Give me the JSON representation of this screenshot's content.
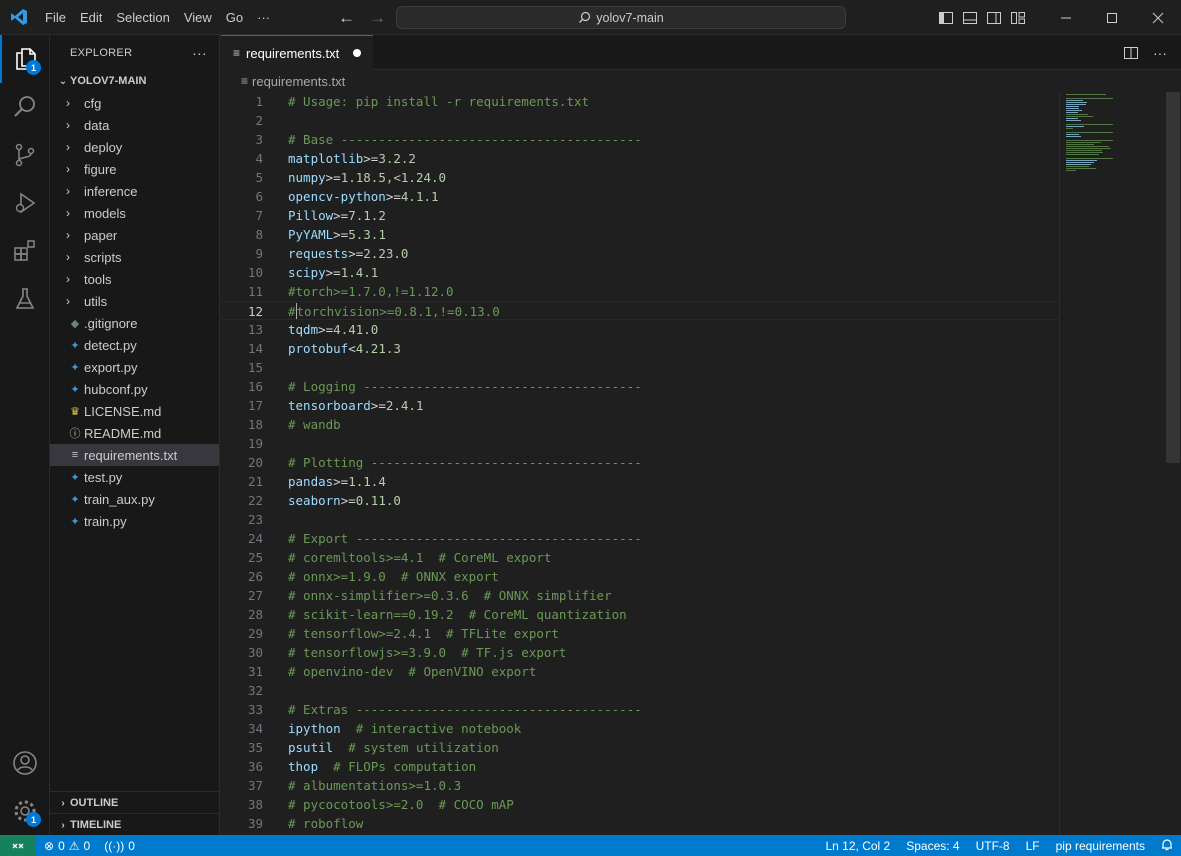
{
  "titlebar": {
    "menu": [
      "File",
      "Edit",
      "Selection",
      "View",
      "Go",
      "···"
    ],
    "command_center": "yolov7-main"
  },
  "activity_bar": {
    "explorer_badge": "1",
    "manage_badge": "1"
  },
  "sidebar": {
    "title": "EXPLORER",
    "more": "···",
    "root_folder": "YOLOV7-MAIN",
    "folders": [
      "cfg",
      "data",
      "deploy",
      "figure",
      "inference",
      "models",
      "paper",
      "scripts",
      "tools",
      "utils"
    ],
    "files": [
      {
        "name": ".gitignore",
        "icon": "gitignore-icon"
      },
      {
        "name": "detect.py",
        "icon": "python-icon"
      },
      {
        "name": "export.py",
        "icon": "python-icon"
      },
      {
        "name": "hubconf.py",
        "icon": "python-icon"
      },
      {
        "name": "LICENSE.md",
        "icon": "license-icon"
      },
      {
        "name": "README.md",
        "icon": "info-icon"
      },
      {
        "name": "requirements.txt",
        "icon": "text-file-icon"
      },
      {
        "name": "test.py",
        "icon": "python-icon"
      },
      {
        "name": "train_aux.py",
        "icon": "python-icon"
      },
      {
        "name": "train.py",
        "icon": "python-icon"
      }
    ],
    "outline": "OUTLINE",
    "timeline": "TIMELINE"
  },
  "editor": {
    "tab_label": "requirements.txt",
    "breadcrumb": "requirements.txt",
    "current_line": 12,
    "lines": [
      {
        "n": "1",
        "kind": "comment",
        "text": "# Usage: pip install -r requirements.txt"
      },
      {
        "n": "2",
        "kind": "blank",
        "text": ""
      },
      {
        "n": "3",
        "kind": "comment",
        "text": "# Base ----------------------------------------"
      },
      {
        "n": "4",
        "kind": "pkg",
        "name": "matplotlib",
        "op": ">=",
        "ver": "3.2.2"
      },
      {
        "n": "5",
        "kind": "pkg",
        "name": "numpy",
        "op": ">=",
        "ver": "1.18.5,<1.24.0"
      },
      {
        "n": "6",
        "kind": "pkg",
        "name": "opencv-python",
        "op": ">=",
        "ver": "4.1.1"
      },
      {
        "n": "7",
        "kind": "pkg",
        "name": "Pillow",
        "op": ">=",
        "ver": "7.1.2"
      },
      {
        "n": "8",
        "kind": "pkg",
        "name": "PyYAML",
        "op": ">=",
        "ver": "5.3.1"
      },
      {
        "n": "9",
        "kind": "pkg",
        "name": "requests",
        "op": ">=",
        "ver": "2.23.0"
      },
      {
        "n": "10",
        "kind": "pkg",
        "name": "scipy",
        "op": ">=",
        "ver": "1.4.1"
      },
      {
        "n": "11",
        "kind": "comment",
        "text": "#torch>=1.7.0,!=1.12.0"
      },
      {
        "n": "12",
        "kind": "cursorcomment",
        "pre": "#",
        "text": "torchvision>=0.8.1,!=0.13.0"
      },
      {
        "n": "13",
        "kind": "pkg",
        "name": "tqdm",
        "op": ">=",
        "ver": "4.41.0"
      },
      {
        "n": "14",
        "kind": "pkg",
        "name": "protobuf",
        "op": "<",
        "ver": "4.21.3"
      },
      {
        "n": "15",
        "kind": "blank",
        "text": ""
      },
      {
        "n": "16",
        "kind": "comment",
        "text": "# Logging -------------------------------------"
      },
      {
        "n": "17",
        "kind": "pkg",
        "name": "tensorboard",
        "op": ">=",
        "ver": "2.4.1"
      },
      {
        "n": "18",
        "kind": "comment",
        "text": "# wandb"
      },
      {
        "n": "19",
        "kind": "blank",
        "text": ""
      },
      {
        "n": "20",
        "kind": "comment",
        "text": "# Plotting ------------------------------------"
      },
      {
        "n": "21",
        "kind": "pkg",
        "name": "pandas",
        "op": ">=",
        "ver": "1.1.4"
      },
      {
        "n": "22",
        "kind": "pkg",
        "name": "seaborn",
        "op": ">=",
        "ver": "0.11.0"
      },
      {
        "n": "23",
        "kind": "blank",
        "text": ""
      },
      {
        "n": "24",
        "kind": "comment",
        "text": "# Export --------------------------------------"
      },
      {
        "n": "25",
        "kind": "comment",
        "text": "# coremltools>=4.1  # CoreML export"
      },
      {
        "n": "26",
        "kind": "comment",
        "text": "# onnx>=1.9.0  # ONNX export"
      },
      {
        "n": "27",
        "kind": "comment",
        "text": "# onnx-simplifier>=0.3.6  # ONNX simplifier"
      },
      {
        "n": "28",
        "kind": "comment",
        "text": "# scikit-learn==0.19.2  # CoreML quantization"
      },
      {
        "n": "29",
        "kind": "comment",
        "text": "# tensorflow>=2.4.1  # TFLite export"
      },
      {
        "n": "30",
        "kind": "comment",
        "text": "# tensorflowjs>=3.9.0  # TF.js export"
      },
      {
        "n": "31",
        "kind": "comment",
        "text": "# openvino-dev  # OpenVINO export"
      },
      {
        "n": "32",
        "kind": "blank",
        "text": ""
      },
      {
        "n": "33",
        "kind": "comment",
        "text": "# Extras --------------------------------------"
      },
      {
        "n": "34",
        "kind": "pkgc",
        "name": "ipython",
        "comment": "  # interactive notebook"
      },
      {
        "n": "35",
        "kind": "pkgc",
        "name": "psutil",
        "comment": "  # system utilization"
      },
      {
        "n": "36",
        "kind": "pkgc",
        "name": "thop",
        "comment": "  # FLOPs computation"
      },
      {
        "n": "37",
        "kind": "comment",
        "text": "# albumentations>=1.0.3"
      },
      {
        "n": "38",
        "kind": "comment",
        "text": "# pycocotools>=2.0  # COCO mAP"
      },
      {
        "n": "39",
        "kind": "comment",
        "text": "# roboflow"
      }
    ]
  },
  "statusbar": {
    "errors": "0",
    "warnings": "0",
    "ports": "0",
    "position": "Ln 12, Col 2",
    "spaces": "Spaces: 4",
    "encoding": "UTF-8",
    "eol": "LF",
    "language": "pip requirements"
  },
  "colors": {
    "accent": "#0078d4",
    "statusbar": "#007acc",
    "remote": "#16825d",
    "comment": "#6a9955",
    "package": "#9cdcfe",
    "version": "#b5cea8"
  }
}
